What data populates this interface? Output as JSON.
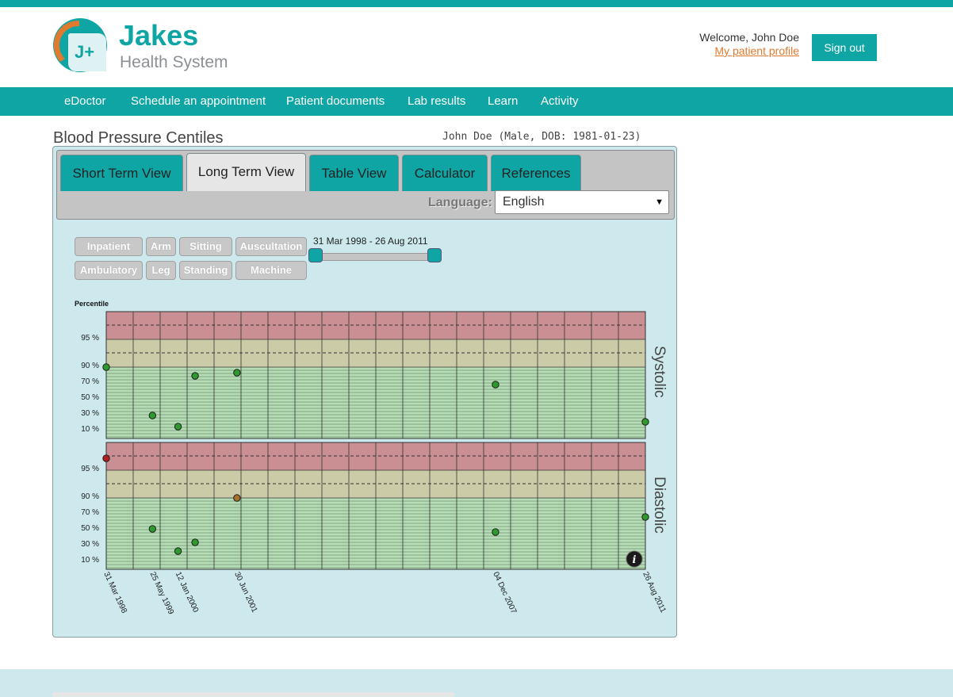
{
  "brand": {
    "name": "Jakes",
    "subtitle": "Health System",
    "mark_letter": "J+"
  },
  "header": {
    "welcome": "Welcome, John Doe",
    "profile_link": "My patient profile",
    "signout_label": "Sign out"
  },
  "nav": {
    "items": [
      "eDoctor",
      "Schedule an appointment",
      "Patient documents",
      "Lab results",
      "Learn",
      "Activity"
    ]
  },
  "page": {
    "title": "Blood Pressure Centiles",
    "patient": "John Doe (Male, DOB: 1981-01-23)"
  },
  "tabs": [
    {
      "label": "Short Term View",
      "active": false
    },
    {
      "label": "Long Term View",
      "active": true
    },
    {
      "label": "Table View",
      "active": false
    },
    {
      "label": "Calculator",
      "active": false
    },
    {
      "label": "References",
      "active": false
    }
  ],
  "language": {
    "label": "Language:",
    "selected": "English"
  },
  "filters": {
    "row1": [
      "Inpatient",
      "Arm",
      "Sitting",
      "Auscultation"
    ],
    "row2": [
      "Ambulatory",
      "Leg",
      "Standing",
      "Machine"
    ]
  },
  "range": {
    "label": "31 Mar 1998 - 26 Aug 2011",
    "start_fraction": 0,
    "end_fraction": 1
  },
  "colors": {
    "brand_teal": "#0fa5a5",
    "accent_orange": "#e07a2f",
    "zone_high": "#c98f92",
    "zone_mid": "#cccba8",
    "zone_normal": "#b5ddb5",
    "point_normal": "#2e9a2e",
    "point_warning": "#a8702a",
    "point_high": "#b02020"
  },
  "chart_data": {
    "type": "scatter",
    "ylabel": "Percentile",
    "y_ticks": [
      "95 %",
      "90 %",
      "70 %",
      "50 %",
      "30 %",
      "10 %"
    ],
    "x_tick_labels": [
      "31 Mar 1998",
      "25 May 1999",
      "12 Jan 2000",
      "30 Jun 2001",
      "04 Dec 2007",
      "26 Aug 2011"
    ],
    "series": [
      {
        "name": "Systolic",
        "points": [
          {
            "x": "31 Mar 1998",
            "y": 90,
            "status": "normal"
          },
          {
            "x": "25 May 1999",
            "y": 29,
            "status": "normal"
          },
          {
            "x": "12 Jan 2000",
            "y": 15,
            "status": "normal"
          },
          {
            "x": "15 Jun 2000",
            "y": 79,
            "status": "normal"
          },
          {
            "x": "30 Jun 2001",
            "y": 83,
            "status": "normal"
          },
          {
            "x": "04 Dec 2007",
            "y": 68,
            "status": "normal"
          },
          {
            "x": "26 Aug 2011",
            "y": 21,
            "status": "normal"
          }
        ]
      },
      {
        "name": "Diastolic",
        "points": [
          {
            "x": "31 Mar 1998",
            "y": 99,
            "status": "high"
          },
          {
            "x": "25 May 1999",
            "y": 51,
            "status": "normal"
          },
          {
            "x": "12 Jan 2000",
            "y": 23,
            "status": "normal"
          },
          {
            "x": "15 Jun 2000",
            "y": 34,
            "status": "normal"
          },
          {
            "x": "30 Jun 2001",
            "y": 94,
            "status": "warning"
          },
          {
            "x": "04 Dec 2007",
            "y": 47,
            "status": "normal"
          },
          {
            "x": "26 Aug 2011",
            "y": 66,
            "status": "normal"
          }
        ]
      }
    ],
    "info_icon": "info-icon"
  }
}
